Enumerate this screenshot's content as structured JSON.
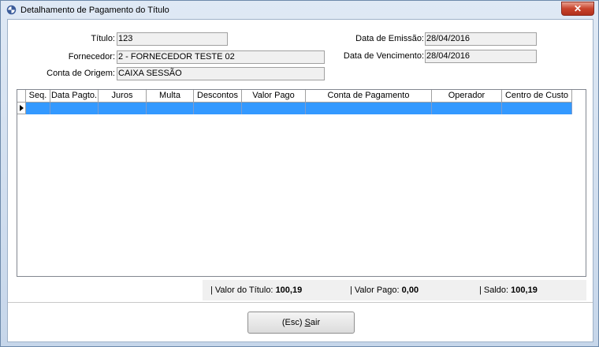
{
  "window": {
    "title": "Detalhamento de Pagamento do Título",
    "close_glyph": "✕"
  },
  "form": {
    "titulo_label": "Título:",
    "titulo_value": "123",
    "fornecedor_label": "Fornecedor:",
    "fornecedor_value": "2 - FORNECEDOR TESTE 02",
    "conta_origem_label": "Conta de Origem:",
    "conta_origem_value": "CAIXA SESSÃO",
    "data_emissao_label": "Data de Emissão:",
    "data_emissao_value": "28/04/2016",
    "data_vencimento_label": "Data de Vencimento:",
    "data_vencimento_value": "28/04/2016"
  },
  "grid": {
    "columns": [
      "Seq.",
      "Data Pagto.",
      "Juros",
      "Multa",
      "Descontos",
      "Valor Pago",
      "Conta de Pagamento",
      "Operador",
      "Centro de Custo"
    ],
    "selected_row_color": "#3399ff"
  },
  "summary": {
    "valor_titulo_label": "| Valor do Título:",
    "valor_titulo_value": "100,19",
    "valor_pago_label": "| Valor Pago:",
    "valor_pago_value": "0,00",
    "saldo_label": "| Saldo:",
    "saldo_value": "100,19"
  },
  "buttons": {
    "sair_label_prefix": "(Esc) ",
    "sair_label_accel": "S",
    "sair_label_rest": "air"
  },
  "icons": {
    "app": "app-icon",
    "close": "close-icon",
    "row_indicator": "row-indicator-arrow-icon"
  }
}
